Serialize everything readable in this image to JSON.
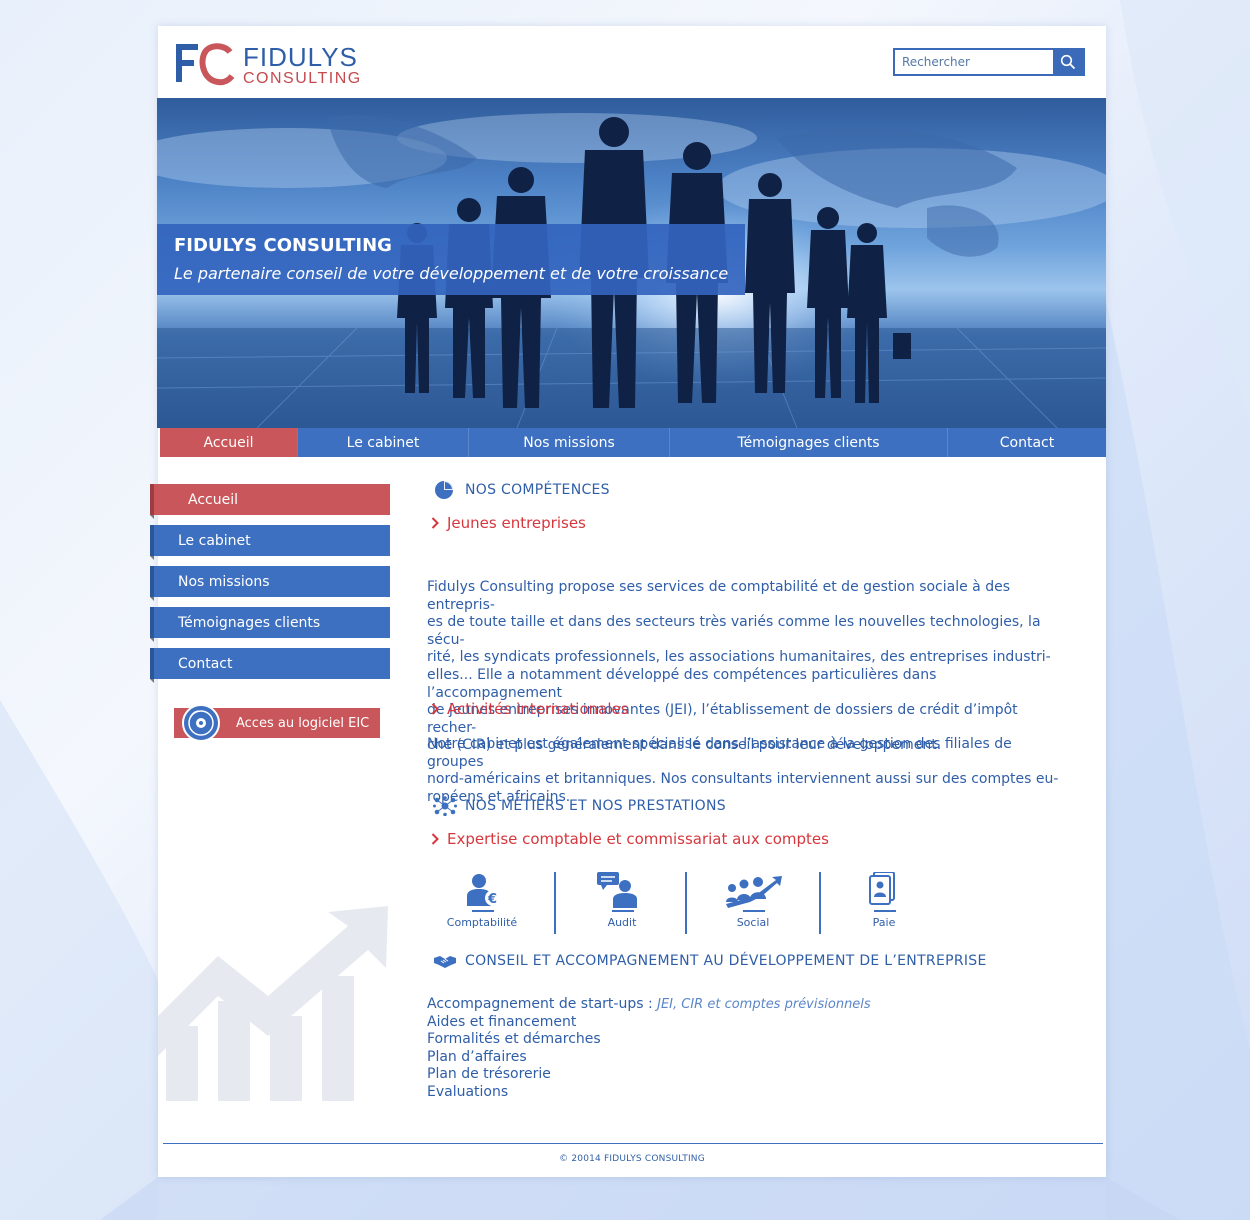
{
  "brand": {
    "logo_text_top": "FIDULYS",
    "logo_text_bottom": "CONSULTING",
    "primary_color": "#3d70c0",
    "accent_color": "#c8565a",
    "link_red": "#d6373d"
  },
  "search": {
    "placeholder": "Rechercher"
  },
  "hero": {
    "title": "FIDULYS CONSULTING",
    "subtitle": "Le partenaire conseil de votre développement et de votre croissance"
  },
  "topnav": {
    "items": [
      {
        "label": "Accueil",
        "active": true
      },
      {
        "label": "Le cabinet",
        "active": false
      },
      {
        "label": "Nos missions",
        "active": false
      },
      {
        "label": "Témoignages clients",
        "active": false
      },
      {
        "label": "Contact",
        "active": false
      }
    ]
  },
  "sidemenu": {
    "items": [
      {
        "label": "Accueil",
        "active": true
      },
      {
        "label": "Le cabinet",
        "active": false
      },
      {
        "label": "Nos missions",
        "active": false
      },
      {
        "label": "Témoignages clients",
        "active": false
      },
      {
        "label": "Contact",
        "active": false
      }
    ],
    "eic_button": "Acces au logiciel EIC"
  },
  "competences": {
    "title": "NOS COMPÉTENCES",
    "icon": "pie-chart-icon",
    "jeunes": {
      "title": "Jeunes entreprises",
      "lines": [
        "Fidulys Consulting propose ses services de comptabilité et de gestion sociale à des entrepris-",
        "es de toute taille et dans des secteurs très variés comme les nouvelles technologies, la sécu-",
        "rité, les syndicats professionnels, les associations humanitaires, des entreprises industri-",
        "elles... Elle a notamment développé des compétences particulières dans l’accompagnement",
        "de jeunes entreprises innovantes (JEI), l’établissement de dossiers de crédit d’impôt recher-",
        "che (CIR) et plus généralement dans le conseil pour leur développement."
      ]
    },
    "international": {
      "title": "Activités internationales",
      "lines": [
        "Notre cabinet est également spécialisé dans l’assistance à la gestion des filiales de groupes",
        "nord-américains et britanniques. Nos consultants interviennent aussi sur des comptes eu-",
        "ropéens et africains."
      ]
    }
  },
  "metiers": {
    "title": "NOS MÉTIERS ET NOS PRESTATIONS",
    "icon": "network-people-icon",
    "expertise_title": "Expertise comptable et commissariat aux comptes",
    "services": [
      {
        "label": "Comptabilité",
        "icon": "accountant-euro-icon"
      },
      {
        "label": "Audit",
        "icon": "consultation-icon"
      },
      {
        "label": "Social",
        "icon": "team-growth-icon"
      },
      {
        "label": "Paie",
        "icon": "payslip-icon"
      }
    ]
  },
  "conseil": {
    "title": "CONSEIL ET ACCOMPAGNEMENT AU DÉVELOPPEMENT DE L’ENTREPRISE",
    "icon": "handshake-icon",
    "first_item": "Accompagnement de start-ups : ",
    "first_item_note": "JEI, CIR et comptes prévisionnels",
    "items": [
      "Aides et financement",
      "Formalités et démarches",
      "Plan d’affaires",
      "Plan de trésorerie",
      "Evaluations"
    ]
  },
  "footer": {
    "copyright": "© 20014 FIDULYS CONSULTING"
  }
}
